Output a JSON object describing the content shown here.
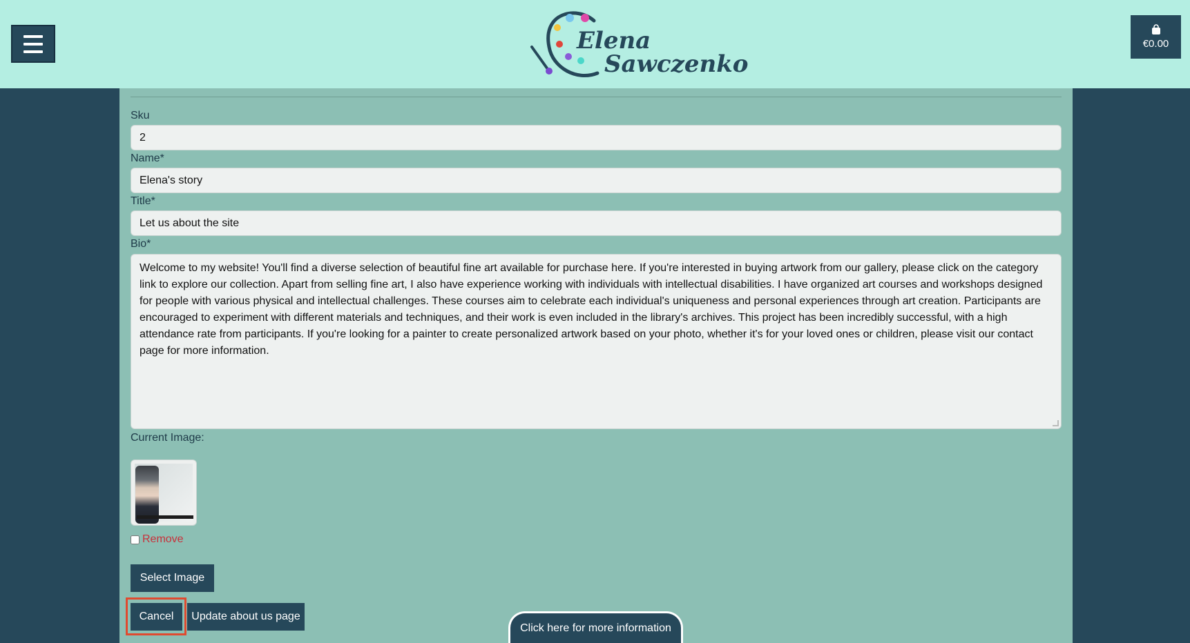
{
  "header": {
    "menu_icon": "hamburger-icon",
    "logo": {
      "line1": "Elena",
      "line2": "Sawczenko"
    },
    "cart": {
      "icon": "shopping-bag-icon",
      "total": "€0.00"
    }
  },
  "form": {
    "sku": {
      "label": "Sku",
      "value": "2"
    },
    "name": {
      "label": "Name*",
      "value": "Elena's story"
    },
    "title": {
      "label": "Title*",
      "value": "Let us about the site"
    },
    "bio": {
      "label": "Bio*",
      "value": "Welcome to my website! You'll find a diverse selection of beautiful fine art available for purchase here. If you're interested in buying artwork from our gallery, please click on the category link to explore our collection. Apart from selling fine art, I also have experience working with individuals with intellectual disabilities. I have organized art courses and workshops designed for people with various physical and intellectual challenges. These courses aim to celebrate each individual's uniqueness and personal experiences through art creation. Participants are encouraged to experiment with different materials and techniques, and their work is even included in the library's archives. This project has been incredibly successful, with a high attendance rate from participants. If you're looking for a painter to create personalized artwork based on your photo, whether it's for your loved ones or children, please visit our contact page for more information."
    },
    "current_image_label": "Current Image:",
    "remove_label": "Remove",
    "select_image_label": "Select Image",
    "cancel_label": "Cancel",
    "update_label": "Update about us page"
  },
  "info_button": "Click here for more information",
  "colors": {
    "header_bg": "#b4eee2",
    "page_bg": "#26485a",
    "panel_bg": "#8cbfb4",
    "button_bg": "#26485a",
    "remove_text": "#c8303a",
    "highlight_border": "#e04a2f"
  }
}
